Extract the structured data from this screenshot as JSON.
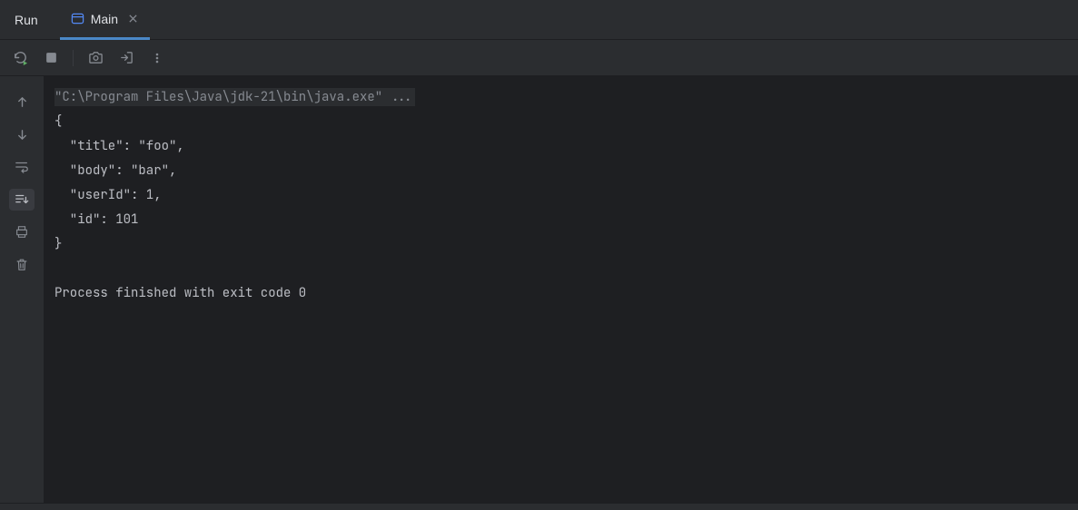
{
  "tabs": {
    "run_label": "Run",
    "main_label": "Main"
  },
  "console": {
    "command_line": "\"C:\\Program Files\\Java\\jdk-21\\bin\\java.exe\" ...",
    "output": "{\n  \"title\": \"foo\",\n  \"body\": \"bar\",\n  \"userId\": 1,\n  \"id\": 101\n}\n\nProcess finished with exit code 0"
  }
}
